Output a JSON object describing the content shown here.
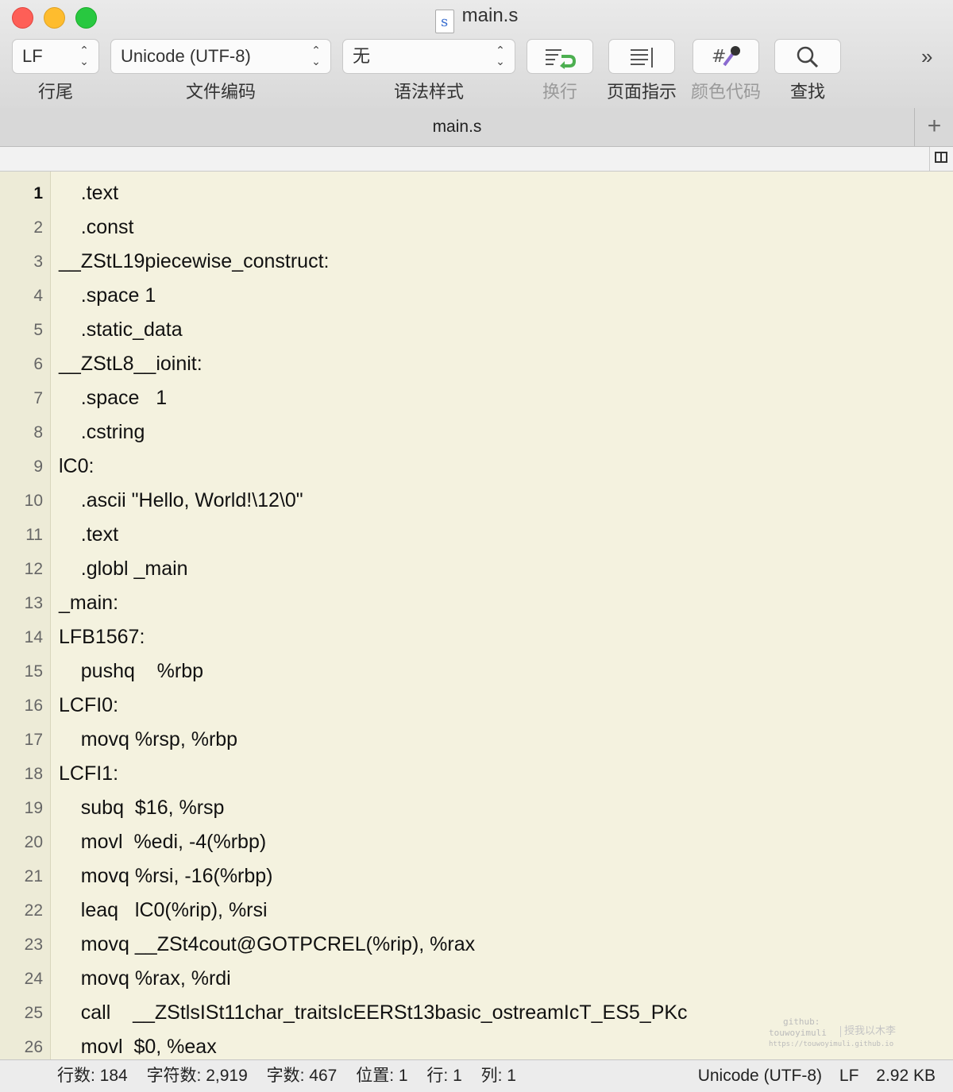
{
  "window": {
    "title": "main.s",
    "file_icon_letter": "s"
  },
  "toolbar": {
    "line_ending": {
      "value": "LF",
      "label": "行尾"
    },
    "encoding": {
      "value": "Unicode (UTF-8)",
      "label": "文件编码"
    },
    "syntax": {
      "value": "无",
      "label": "语法样式"
    },
    "wrap": {
      "label": "换行"
    },
    "page_guide": {
      "label": "页面指示"
    },
    "color_code": {
      "label": "颜色代码"
    },
    "find": {
      "label": "查找"
    },
    "overflow": "»"
  },
  "tabs": [
    {
      "label": "main.s"
    }
  ],
  "editor": {
    "current_line": 1,
    "lines": [
      {
        "n": "1",
        "text": "    .text"
      },
      {
        "n": "2",
        "text": "    .const"
      },
      {
        "n": "3",
        "text": "__ZStL19piecewise_construct:"
      },
      {
        "n": "4",
        "text": "    .space 1"
      },
      {
        "n": "5",
        "text": "    .static_data"
      },
      {
        "n": "6",
        "text": "__ZStL8__ioinit:"
      },
      {
        "n": "7",
        "text": "    .space   1"
      },
      {
        "n": "8",
        "text": "    .cstring"
      },
      {
        "n": "9",
        "text": "lC0:"
      },
      {
        "n": "10",
        "text": "    .ascii \"Hello, World!\\12\\0\""
      },
      {
        "n": "11",
        "text": "    .text"
      },
      {
        "n": "12",
        "text": "    .globl _main"
      },
      {
        "n": "13",
        "text": "_main:"
      },
      {
        "n": "14",
        "text": "LFB1567:"
      },
      {
        "n": "15",
        "text": "    pushq    %rbp"
      },
      {
        "n": "16",
        "text": "LCFI0:"
      },
      {
        "n": "17",
        "text": "    movq %rsp, %rbp"
      },
      {
        "n": "18",
        "text": "LCFI1:"
      },
      {
        "n": "19",
        "text": "    subq  $16, %rsp"
      },
      {
        "n": "20",
        "text": "    movl  %edi, -4(%rbp)"
      },
      {
        "n": "21",
        "text": "    movq %rsi, -16(%rbp)"
      },
      {
        "n": "22",
        "text": "    leaq   lC0(%rip), %rsi"
      },
      {
        "n": "23",
        "text": "    movq __ZSt4cout@GOTPCREL(%rip), %rax"
      },
      {
        "n": "24",
        "text": "    movq %rax, %rdi"
      },
      {
        "n": "25",
        "text": "    call    __ZStlsISt11char_traitsIcEERSt13basic_ostreamIcT_ES5_PKc"
      },
      {
        "n": "26",
        "text": "    movl  $0, %eax"
      }
    ]
  },
  "watermark": {
    "line1": "github:",
    "line2": "touwoyimuli",
    "line3": "https://touwoyimuli.github.io",
    "cn": "授我以木李"
  },
  "status": {
    "lines": "行数: 184",
    "chars": "字符数: 2,919",
    "words": "字数: 467",
    "position": "位置: 1",
    "row": "行: 1",
    "col": "列: 1",
    "encoding": "Unicode (UTF-8)",
    "line_ending": "LF",
    "size": "2.92 KB"
  }
}
